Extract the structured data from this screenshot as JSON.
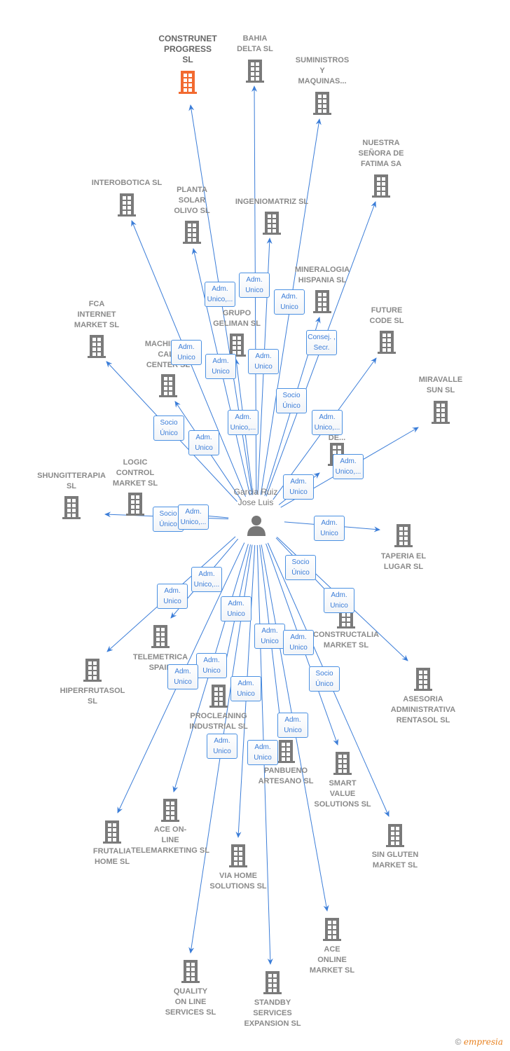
{
  "center": {
    "name": "Garcia Ruiz\nJose Luis",
    "icon": "person-icon"
  },
  "colors": {
    "edge": "#3b7dd8",
    "node": "#7a7a7a",
    "highlight": "#f26a30"
  },
  "nodes": [
    {
      "name": "CONSTRUNET\nPROGRESS\nSL",
      "highlight": true
    },
    {
      "name": "BAHIA\nDELTA SL"
    },
    {
      "name": "SUMINISTROS\nY\nMAQUINAS..."
    },
    {
      "name": "NUESTRA\nSEÑORA DE\nFATIMA SA"
    },
    {
      "name": "INTEROBOTICA SL"
    },
    {
      "name": "PLANTA\nSOLAR\nOLIVO SL"
    },
    {
      "name": "INGENIOMATRIZ SL"
    },
    {
      "name": "MINERALOGIA\nHISPANIA SL"
    },
    {
      "name": "GRUPO\nGELIMAN SL"
    },
    {
      "name": "FCA\nINTERNET\nMARKET SL"
    },
    {
      "name": "FUTURE\nCODE SL"
    },
    {
      "name": "MACHINERY\nCALL\nCENTER SL"
    },
    {
      "name": "MIRAVALLE\nSUN SL"
    },
    {
      "name": "O\nZA\nDE..."
    },
    {
      "name": "LOGIC\nCONTROL\nMARKET SL"
    },
    {
      "name": "SHUNGITTERAPIA\nSL"
    },
    {
      "name": "TAPERIA EL\nLUGAR SL"
    },
    {
      "name": "CONSTRUCTALIA\nMARKET SL"
    },
    {
      "name": "ASESORIA\nADMINISTRATIVA\nRENTASOL SL"
    },
    {
      "name": "TELEMETRICA\nSPAIN"
    },
    {
      "name": "HIPERFRUTASOL\nSL"
    },
    {
      "name": "PROCLEANING\nINDUSTRIAL SL"
    },
    {
      "name": "PANBUENO\nARTESANO SL"
    },
    {
      "name": "SMART\nVALUE\nSOLUTIONS SL"
    },
    {
      "name": "FRUTALIA\nHOME SL"
    },
    {
      "name": "ACE ON-\nLINE\nTELEMARKETING SL"
    },
    {
      "name": "SIN GLUTEN\nMARKET SL"
    },
    {
      "name": "VIA HOME\nSOLUTIONS SL"
    },
    {
      "name": "ACE\nONLINE\nMARKET SL"
    },
    {
      "name": "QUALITY\nON LINE\nSERVICES SL"
    },
    {
      "name": "STANDBY\nSERVICES\nEXPANSION SL"
    }
  ],
  "edge_labels": [
    "Adm.\nUnico,...",
    "Adm.\nUnico",
    "Adm.\nUnico",
    "Consej. ,\nSecr.",
    "Adm.\nUnico",
    "Adm.\nUnico",
    "Adm.\nUnico",
    "Socio\nÚnico",
    "Socio\nÚnico",
    "Adm.\nUnico",
    "Adm.\nUnico,...",
    "Adm.\nUnico,...",
    "Adm.\nUnico,...",
    "Adm.\nUnico",
    "Socio\nÚnico",
    "Adm.\nUnico,...",
    "Adm.\nUnico",
    "Socio\nÚnico",
    "Adm.\nUnico",
    "Adm.\nUnico,...",
    "Adm.\nUnico",
    "Adm.\nUnico",
    "Adm.\nUnico",
    "Adm.\nUnico",
    "Adm.\nUnico",
    "Adm.\nUnico",
    "Adm.\nUnico",
    "Socio\nÚnico",
    "Adm.\nUnico",
    "Adm.\nUnico",
    "Adm.\nUnico"
  ],
  "footer": {
    "copyright": "©",
    "brand": "empresia"
  }
}
